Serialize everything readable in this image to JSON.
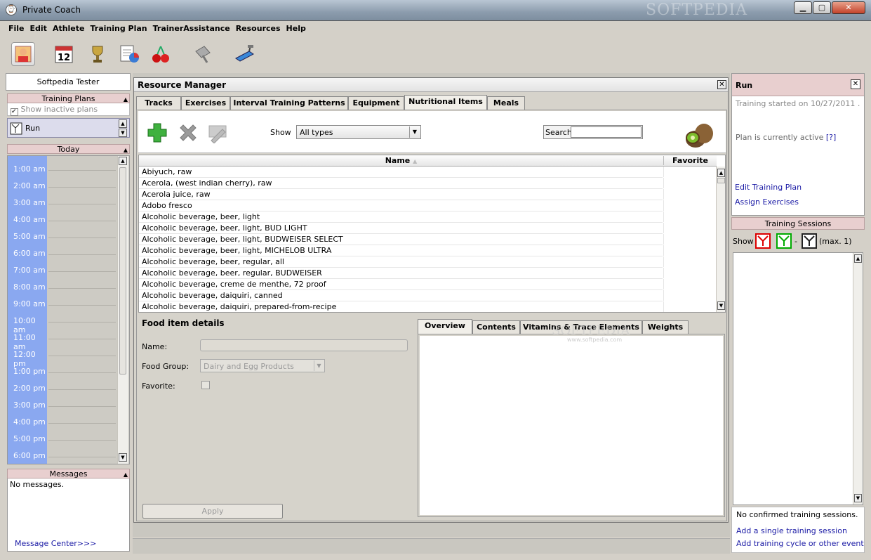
{
  "window": {
    "title": "Private Coach",
    "watermark": "SOFTPEDIA"
  },
  "menu": [
    "File",
    "Edit",
    "Athlete",
    "Training Plan",
    "TrainerAssistance",
    "Resources",
    "Help"
  ],
  "toolbar": {
    "calendar_day": "12"
  },
  "left": {
    "athlete": "Softpedia Tester",
    "plans_header": "Training Plans",
    "show_inactive": "Show inactive plans",
    "plan_item": "Run",
    "today_header": "Today",
    "times": [
      "1:00 am",
      "2:00 am",
      "3:00 am",
      "4:00 am",
      "5:00 am",
      "6:00 am",
      "7:00 am",
      "8:00 am",
      "9:00 am",
      "10:00 am",
      "11:00 am",
      "12:00 pm",
      "1:00 pm",
      "2:00 pm",
      "3:00 pm",
      "4:00 pm",
      "5:00 pm",
      "6:00 pm"
    ],
    "messages_header": "Messages",
    "messages_text": "No messages.",
    "message_center": "Message Center>>>"
  },
  "rm": {
    "title": "Resource Manager",
    "tabs": [
      "Tracks",
      "Exercises",
      "Interval Training Patterns",
      "Equipment",
      "Nutritional Items",
      "Meals"
    ],
    "show_label": "Show",
    "show_value": "All types",
    "search_label": "Search",
    "search_value": "",
    "col_name": "Name",
    "col_favorite": "Favorite",
    "rows": [
      "Abiyuch, raw",
      "Acerola, (west indian cherry), raw",
      "Acerola juice, raw",
      "Adobo fresco",
      "Alcoholic beverage, beer, light",
      "Alcoholic beverage, beer, light, BUD LIGHT",
      "Alcoholic beverage, beer, light, BUDWEISER SELECT",
      "Alcoholic beverage, beer, light, MICHELOB ULTRA",
      "Alcoholic beverage, beer, regular, all",
      "Alcoholic beverage, beer, regular, BUDWEISER",
      "Alcoholic beverage, creme de menthe, 72 proof",
      "Alcoholic beverage, daiquiri, canned",
      "Alcoholic beverage, daiquiri, prepared-from-recipe"
    ],
    "details_title": "Food item details",
    "name_label": "Name:",
    "name_value": "",
    "group_label": "Food Group:",
    "group_value": "Dairy and Egg Products",
    "favorite_label": "Favorite:",
    "detail_tabs": [
      "Overview",
      "Contents",
      "Vitamins & Trace Elements",
      "Weights"
    ],
    "apply": "Apply",
    "watermark": "SOFTPEDIA",
    "watermark_url": "www.softpedia.com"
  },
  "right": {
    "title": "Run",
    "started": "Training started on 10/27/2011 .",
    "active": "Plan is currently active",
    "help": "[?]",
    "edit_plan": "Edit Training Plan",
    "assign": "Assign Exercises",
    "sessions_header": "Training Sessions",
    "show_label": "Show",
    "dash": "-",
    "max": "(max. 1)",
    "no_sessions": "No confirmed training sessions.",
    "add_single": "Add a single training session",
    "add_cycle": "Add training cycle or other event"
  }
}
